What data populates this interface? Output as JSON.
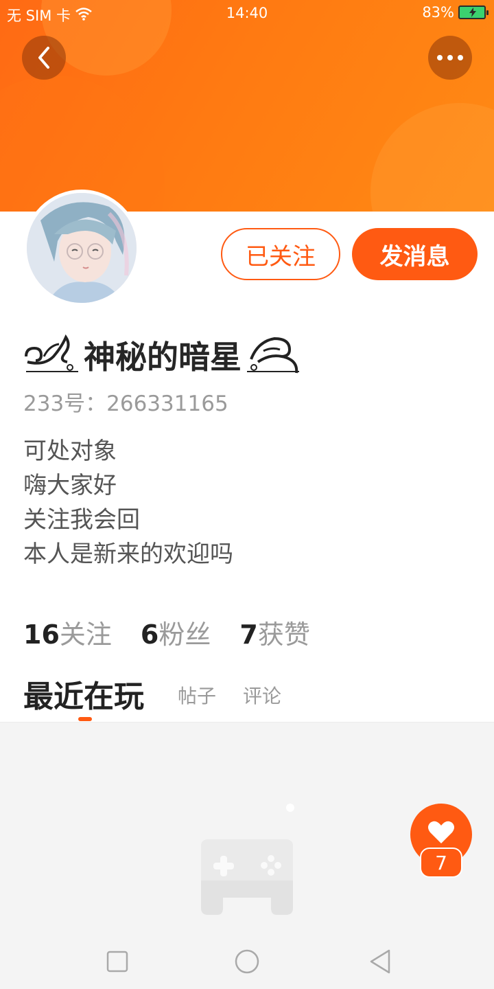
{
  "status_bar": {
    "carrier": "无 SIM 卡",
    "time": "14:40",
    "battery": "83%"
  },
  "header": {
    "back_icon": "chevron-left-icon",
    "more_icon": "more-dots-icon",
    "accent_color": "#ff5a12"
  },
  "profile": {
    "name": "神秘的暗星",
    "id_label": "233号：266331165",
    "bio": [
      "可处对象",
      "嗨大家好",
      "关注我会回",
      "本人是新来的欢迎吗"
    ],
    "follow_label": "已关注",
    "message_label": "发消息"
  },
  "stats": [
    {
      "num": "16",
      "label": "关注"
    },
    {
      "num": "6",
      "label": "粉丝"
    },
    {
      "num": "7",
      "label": "获赞"
    }
  ],
  "tabs": [
    {
      "label": "最近在玩",
      "active": true
    },
    {
      "label": "帖子",
      "active": false
    },
    {
      "label": "评论",
      "active": false
    }
  ],
  "content": {
    "empty_icon": "gamepad-icon"
  },
  "like": {
    "icon": "heart-icon",
    "count": "7"
  },
  "navbar": {
    "icons": [
      "square-recent-icon",
      "circle-home-icon",
      "triangle-back-icon"
    ]
  }
}
